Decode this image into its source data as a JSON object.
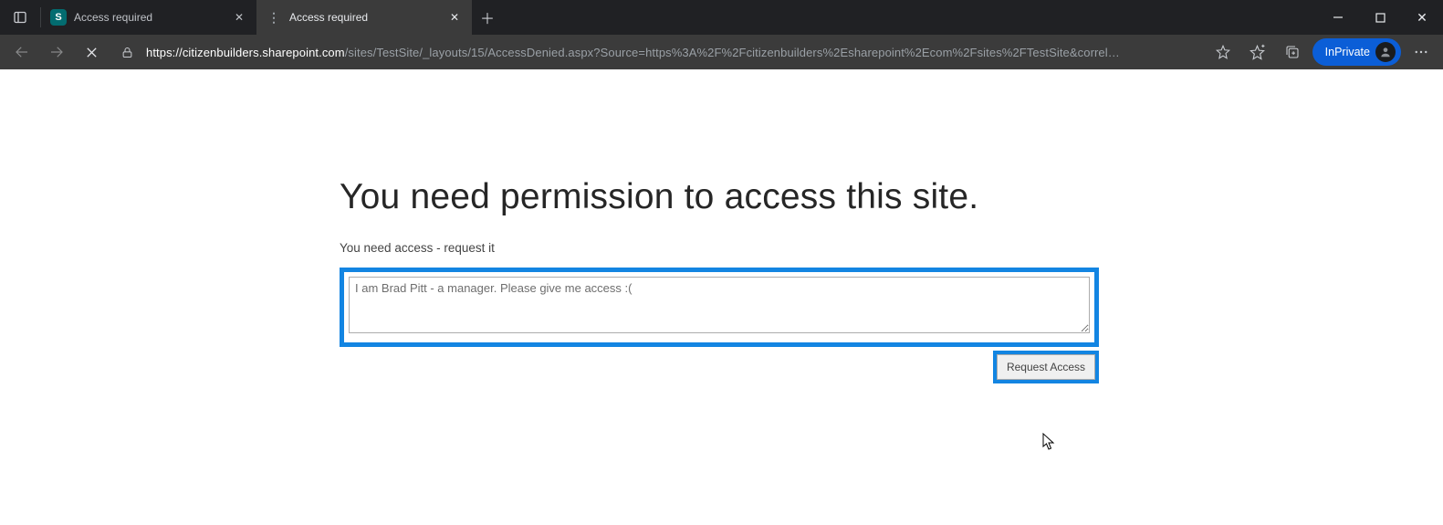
{
  "browser": {
    "tabs": [
      {
        "title": "Access required",
        "favicon": "sharepoint"
      },
      {
        "title": "Access required",
        "favicon": "dots"
      }
    ],
    "url_domain": "https://citizenbuilders.sharepoint.com",
    "url_path": "/sites/TestSite/_layouts/15/AccessDenied.aspx?Source=https%3A%2F%2Fcitizenbuilders%2Esharepoint%2Ecom%2Fsites%2FTestSite&correl…",
    "inprivate_label": "InPrivate"
  },
  "page": {
    "heading": "You need permission to access this site.",
    "subheading": "You need access - request it",
    "message_value": "I am Brad Pitt - a manager. Please give me access :(",
    "request_button": "Request Access"
  },
  "highlight_color": "#1385e2"
}
